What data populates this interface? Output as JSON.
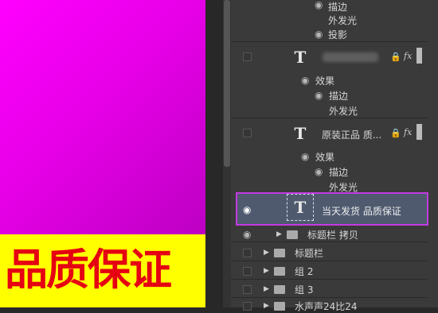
{
  "canvas": {
    "banner_text": "品质保证",
    "bg_color": "#ff00ff",
    "banner_color": "#ffff00",
    "text_color": "#e50012"
  },
  "layers": {
    "effects_top": [
      "描边",
      "外发光",
      "投影"
    ],
    "layer1": {
      "name": "",
      "effects_label": "效果",
      "effects": [
        "描边",
        "外发光"
      ],
      "fx": "fx"
    },
    "layer2": {
      "name": "原装正品  质...",
      "effects_label": "效果",
      "effects": [
        "描边",
        "外发光"
      ],
      "fx": "fx"
    },
    "layer_selected": {
      "name": "当天发货  品质保证"
    },
    "groups": [
      {
        "name": "标题栏 拷贝"
      },
      {
        "name": "标题栏"
      },
      {
        "name": "组 2"
      },
      {
        "name": "组 3"
      },
      {
        "name": "水声声24比24"
      }
    ]
  }
}
